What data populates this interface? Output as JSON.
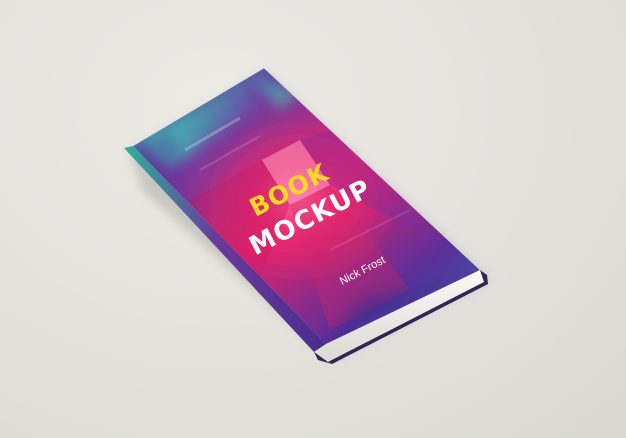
{
  "book": {
    "title_line1": "BOOK",
    "title_line2": "MOCKUP",
    "author": "Nick Frost"
  },
  "colors": {
    "background": "#e4e3de",
    "title_line1": "#f5d923",
    "title_line2": "#ffffff",
    "author": "#ffffff",
    "cover_magenta": "#f0266d",
    "cover_purple": "#4a2c8c",
    "cover_teal": "#3fd1b0",
    "spine": "#2e2755",
    "pages": "#f1f0ec"
  }
}
